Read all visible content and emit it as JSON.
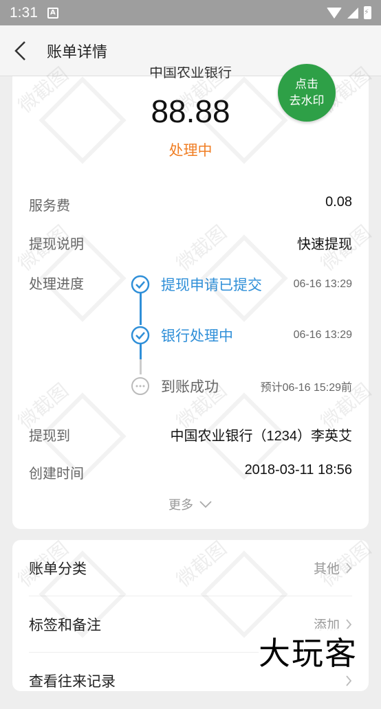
{
  "status_bar": {
    "time": "1:31",
    "notif_letter": "A"
  },
  "app_bar": {
    "title": "账单详情"
  },
  "summary": {
    "bank_name": "中国农业银行",
    "amount": "88.88",
    "status": "处理中",
    "watermark_button": {
      "line1": "点击",
      "line2": "去水印"
    }
  },
  "details": [
    {
      "label": "服务费",
      "value": "0.08"
    },
    {
      "label": "提现说明",
      "value": "快速提现"
    }
  ],
  "progress": {
    "label": "处理进度",
    "steps": [
      {
        "text": "提现申请已提交",
        "time": "06-16 13:29",
        "state": "done"
      },
      {
        "text": "银行处理中",
        "time": "06-16 13:29",
        "state": "done"
      },
      {
        "text": "到账成功",
        "time": "预计06-16 15:29前",
        "state": "pending"
      }
    ]
  },
  "details2": [
    {
      "label": "提现到",
      "value": "中国农业银行（1234）李英艾"
    },
    {
      "label": "创建时间",
      "value": "2018-03-11 18:56"
    }
  ],
  "more": {
    "label": "更多"
  },
  "list": [
    {
      "label": "账单分类",
      "value": "其他"
    },
    {
      "label": "标签和备注",
      "value": "添加"
    },
    {
      "label": "查看往来记录",
      "value": ""
    }
  ],
  "overlay_brand": "大玩客",
  "watermark_text": "微截图",
  "colors": {
    "accent_blue": "#2f8fd8",
    "status_orange": "#f07e24",
    "watermark_green": "#2ea047"
  }
}
